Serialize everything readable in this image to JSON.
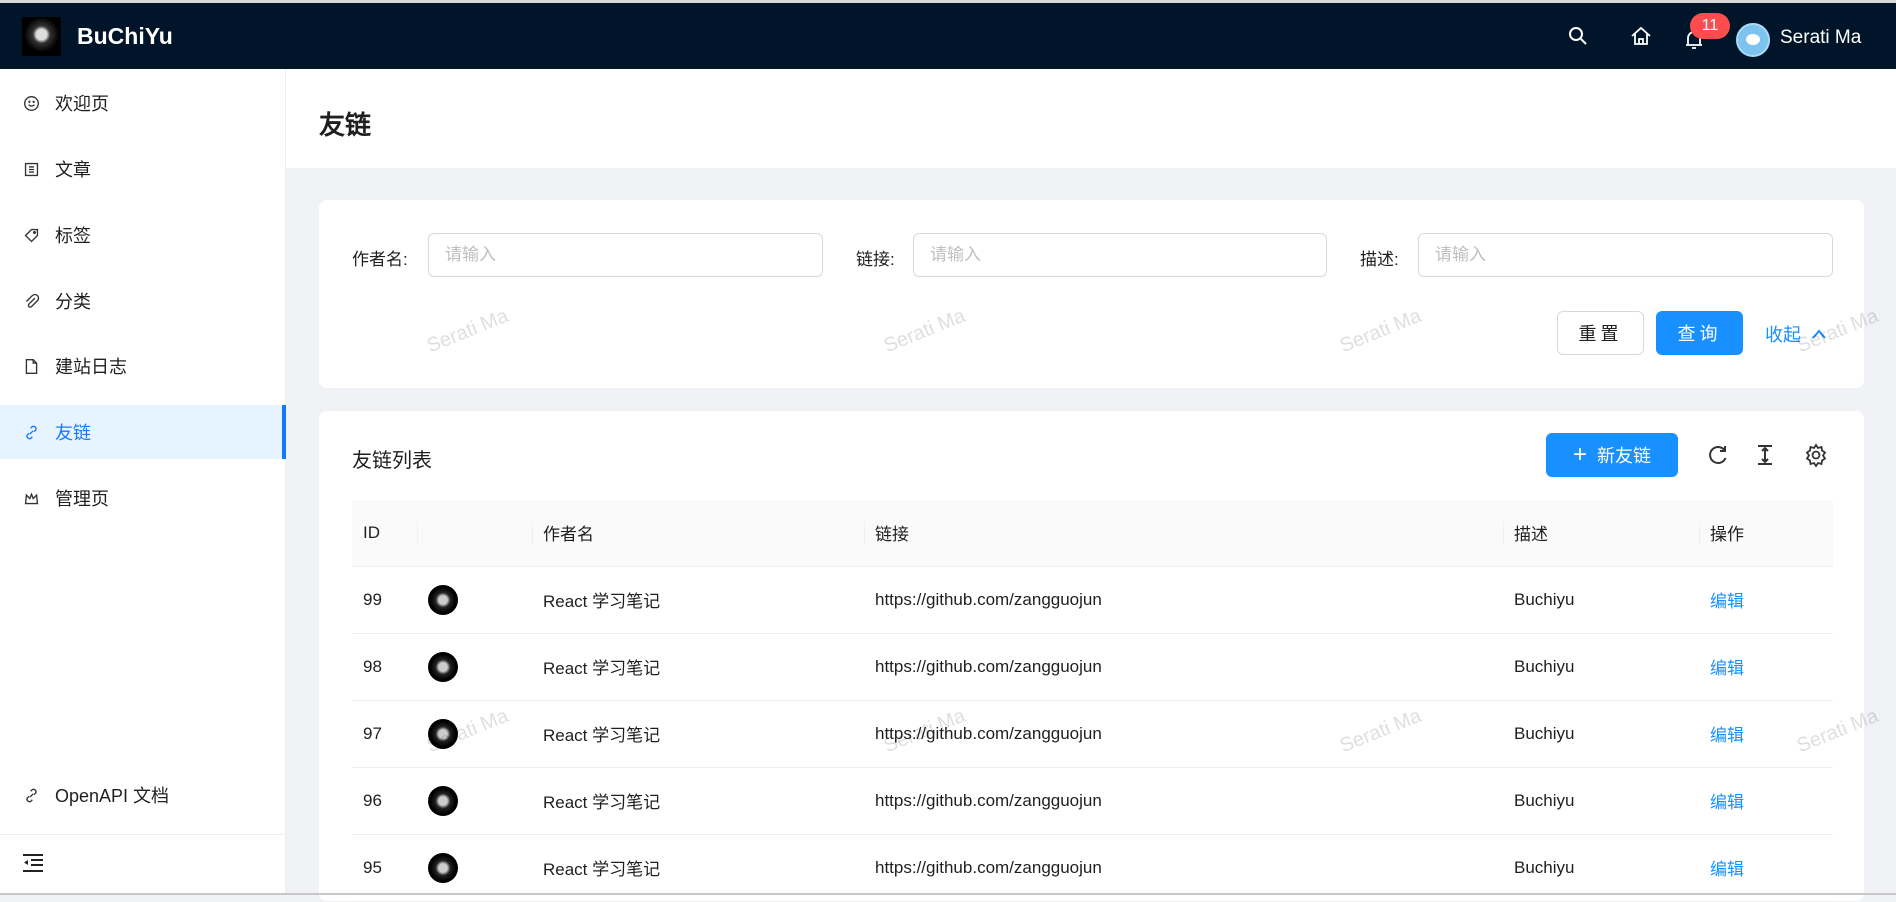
{
  "header": {
    "brand": "BuChiYu",
    "notification_count": "11",
    "username": "Serati Ma"
  },
  "sidebar": {
    "items": [
      {
        "label": "欢迎页",
        "icon": "smile-icon"
      },
      {
        "label": "文章",
        "icon": "list-icon"
      },
      {
        "label": "标签",
        "icon": "tag-icon"
      },
      {
        "label": "分类",
        "icon": "paperclip-icon"
      },
      {
        "label": "建站日志",
        "icon": "file-icon"
      },
      {
        "label": "友链",
        "icon": "link-icon",
        "active": true
      },
      {
        "label": "管理页",
        "icon": "crown-icon"
      }
    ],
    "footer_link": "OpenAPI 文档"
  },
  "page": {
    "title": "友链"
  },
  "search": {
    "fields": [
      {
        "label": "作者名:",
        "placeholder": "请输入"
      },
      {
        "label": "链接:",
        "placeholder": "请输入"
      },
      {
        "label": "描述:",
        "placeholder": "请输入"
      }
    ],
    "reset": "重置",
    "query": "查询",
    "collapse": "收起"
  },
  "table": {
    "title": "友链列表",
    "new_button": "新友链",
    "columns": [
      "ID",
      "",
      "作者名",
      "链接",
      "描述",
      "操作"
    ],
    "rows": [
      {
        "id": "99",
        "author": "React 学习笔记",
        "link": "https://github.com/zangguojun",
        "desc": "Buchiyu",
        "action": "编辑"
      },
      {
        "id": "98",
        "author": "React 学习笔记",
        "link": "https://github.com/zangguojun",
        "desc": "Buchiyu",
        "action": "编辑"
      },
      {
        "id": "97",
        "author": "React 学习笔记",
        "link": "https://github.com/zangguojun",
        "desc": "Buchiyu",
        "action": "编辑"
      },
      {
        "id": "96",
        "author": "React 学习笔记",
        "link": "https://github.com/zangguojun",
        "desc": "Buchiyu",
        "action": "编辑"
      },
      {
        "id": "95",
        "author": "React 学习笔记",
        "link": "https://github.com/zangguojun",
        "desc": "Buchiyu",
        "action": "编辑"
      }
    ]
  },
  "watermark": "Serati Ma",
  "colors": {
    "header_bg": "#001529",
    "primary": "#1890ff",
    "badge": "#ff4d4f"
  }
}
